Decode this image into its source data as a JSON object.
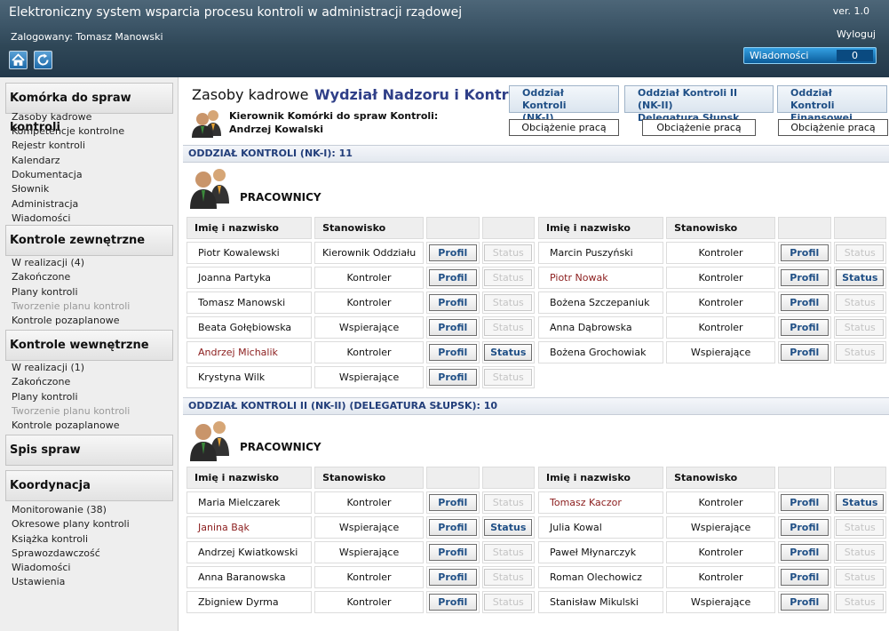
{
  "header": {
    "title": "Elektroniczny system wsparcia procesu kontroli w administracji rządowej",
    "version": "ver. 1.0",
    "logged_in": "Zalogowany: Tomasz Manowski",
    "logout": "Wyloguj",
    "messages_label": "Wiadomości",
    "messages_count": "0",
    "icons": [
      "home-icon",
      "refresh-icon"
    ]
  },
  "sidebar": {
    "sections": [
      {
        "title": "Komórka do spraw kontroli",
        "items": [
          "Zasoby kadrowe",
          "Kompetencje kontrolne",
          "Rejestr kontroli",
          "Kalendarz",
          "Dokumentacja",
          "Słownik",
          "Administracja",
          "Wiadomości"
        ]
      },
      {
        "title": "Kontrole zewnętrzne",
        "items": [
          "W realizacji (4)",
          "Zakończone",
          "Plany kontroli",
          "Tworzenie planu kontroli",
          "Kontrole pozaplanowe"
        ]
      },
      {
        "title": "Kontrole wewnętrzne",
        "items": [
          "W realizacji (1)",
          "Zakończone",
          "Plany kontroli",
          "Tworzenie planu kontroli",
          "Kontrole pozaplanowe"
        ]
      },
      {
        "title": "Spis spraw",
        "items": []
      },
      {
        "title": "Koordynacja",
        "items": [
          "Monitorowanie (38)",
          "Okresowe plany kontroli",
          "Książka kontroli",
          "Sprawozdawczość",
          "Wiadomości",
          "Ustawienia"
        ]
      }
    ]
  },
  "main": {
    "title": "Zasoby kadrowe",
    "subtitle": "Wydział Nadzoru i Kontroli",
    "manager_role": "Kierownik Komórki do spraw Kontroli:",
    "manager_name": "Andrzej Kowalski",
    "unit_buttons": [
      {
        "line1": "Oddział Kontroli",
        "line2": "(NK-I)"
      },
      {
        "line1": "Oddział Kontroli II (NK-II)",
        "line2": "Delegatura Słupsk"
      },
      {
        "line1": "Oddział Kontroli",
        "line2": "Finansowej (NK-III)"
      }
    ],
    "load_button": "Obciążenie pracą",
    "employees_heading": "PRACOWNICY",
    "columns": {
      "name": "Imię i nazwisko",
      "position": "Stanowisko"
    },
    "profile_label": "Profil",
    "status_label": "Status",
    "departments": [
      {
        "title": "ODDZIAŁ KONTROLI (NK-I): 11",
        "left": [
          {
            "name": "Piotr Kowalewski",
            "position": "Kierownik Oddziału",
            "highlight": false,
            "status": false
          },
          {
            "name": "Joanna Partyka",
            "position": "Kontroler",
            "highlight": false,
            "status": false
          },
          {
            "name": "Tomasz Manowski",
            "position": "Kontroler",
            "highlight": false,
            "status": false
          },
          {
            "name": "Beata Gołębiowska",
            "position": "Wspierające",
            "highlight": false,
            "status": false
          },
          {
            "name": "Andrzej Michalik",
            "position": "Kontroler",
            "highlight": true,
            "status": true
          },
          {
            "name": "Krystyna Wilk",
            "position": "Wspierające",
            "highlight": false,
            "status": false
          }
        ],
        "right": [
          {
            "name": "Marcin Puszyński",
            "position": "Kontroler",
            "highlight": false,
            "status": false
          },
          {
            "name": "Piotr Nowak",
            "position": "Kontroler",
            "highlight": true,
            "status": true
          },
          {
            "name": "Bożena Szczepaniuk",
            "position": "Kontroler",
            "highlight": false,
            "status": false
          },
          {
            "name": "Anna Dąbrowska",
            "position": "Kontroler",
            "highlight": false,
            "status": false
          },
          {
            "name": "Bożena Grochowiak",
            "position": "Wspierające",
            "highlight": false,
            "status": false
          }
        ]
      },
      {
        "title": "ODDZIAŁ KONTROLI II (NK-II) (DELEGATURA SŁUPSK): 10",
        "left": [
          {
            "name": "Maria Mielczarek",
            "position": "Kontroler",
            "highlight": false,
            "status": false
          },
          {
            "name": "Janina Bąk",
            "position": "Wspierające",
            "highlight": true,
            "status": true
          },
          {
            "name": "Andrzej Kwiatkowski",
            "position": "Wspierające",
            "highlight": false,
            "status": false
          },
          {
            "name": "Anna Baranowska",
            "position": "Kontroler",
            "highlight": false,
            "status": false
          },
          {
            "name": "Zbigniew Dyrma",
            "position": "Kontroler",
            "highlight": false,
            "status": false
          }
        ],
        "right": [
          {
            "name": "Tomasz Kaczor",
            "position": "Kontroler",
            "highlight": true,
            "status": true
          },
          {
            "name": "Julia Kowal",
            "position": "Wspierające",
            "highlight": false,
            "status": false
          },
          {
            "name": "Paweł Młynarczyk",
            "position": "Kontroler",
            "highlight": false,
            "status": false
          },
          {
            "name": "Roman Olechowicz",
            "position": "Kontroler",
            "highlight": false,
            "status": false
          },
          {
            "name": "Stanisław Mikulski",
            "position": "Wspierające",
            "highlight": false,
            "status": false
          }
        ]
      }
    ]
  }
}
